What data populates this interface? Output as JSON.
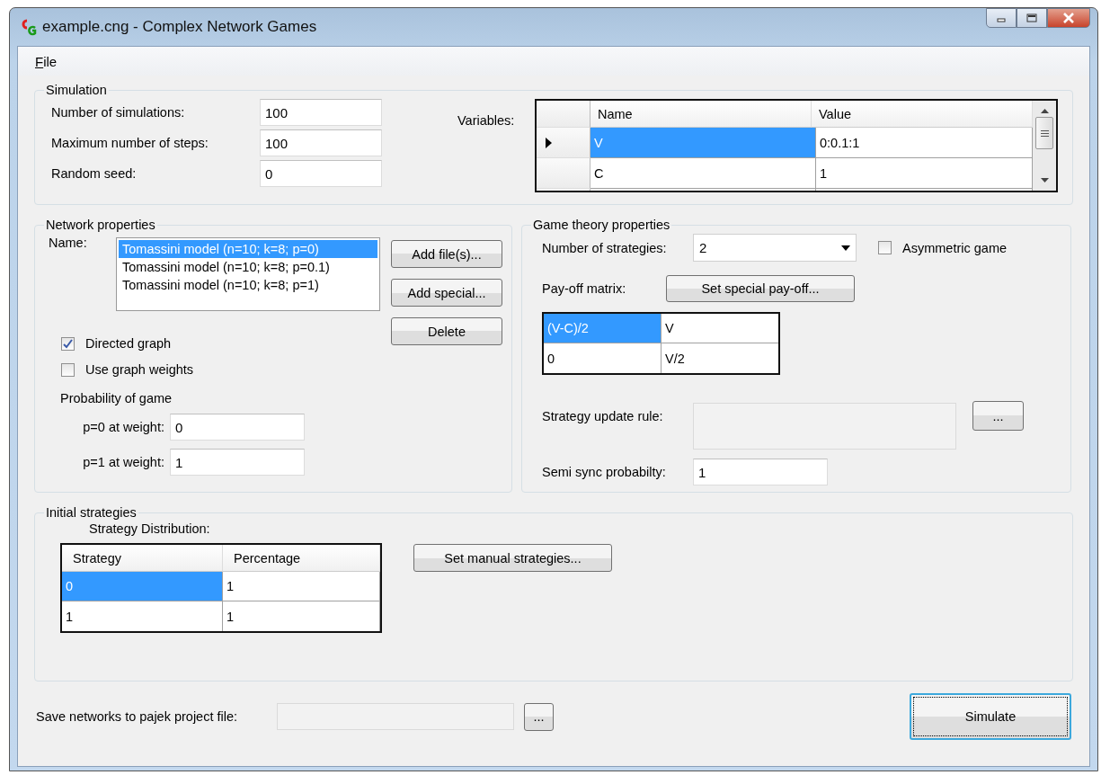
{
  "window": {
    "title": "example.cng - Complex Network Games"
  },
  "menu": [
    {
      "label": "File"
    }
  ],
  "simulation": {
    "title": "Simulation",
    "fields": [
      {
        "label": "Number of simulations:",
        "value": "100"
      },
      {
        "label": "Maximum number of steps:",
        "value": "100"
      },
      {
        "label": "Random seed:",
        "value": "0"
      }
    ],
    "variables": {
      "label": "Variables:",
      "columns": [
        "Name",
        "Value"
      ],
      "rows": [
        {
          "cells": [
            "V",
            "0:0.1:1"
          ],
          "selected": true,
          "current": true
        },
        {
          "cells": [
            "C",
            "1"
          ],
          "selected": false,
          "current": false
        }
      ]
    }
  },
  "network": {
    "title": "Network properties",
    "name_label": "Name:",
    "items": [
      {
        "label": "Tomassini model (n=10; k=8; p=0)",
        "selected": true
      },
      {
        "label": "Tomassini model (n=10; k=8; p=0.1)",
        "selected": false
      },
      {
        "label": "Tomassini model (n=10; k=8; p=1)",
        "selected": false
      }
    ],
    "buttons": [
      "Add file(s)...",
      "Add special...",
      "Delete"
    ],
    "checkboxes": [
      {
        "label": "Directed graph",
        "checked": true
      },
      {
        "label": "Use graph weights",
        "checked": false
      }
    ],
    "probability_label": "Probability of game",
    "weight_fields": [
      {
        "label": "p=0 at weight:",
        "value": "0"
      },
      {
        "label": "p=1 at weight:",
        "value": "1"
      }
    ]
  },
  "game": {
    "title": "Game theory properties",
    "strategies_label": "Number of strategies:",
    "strategies_value": "2",
    "asymmetric": {
      "label": "Asymmetric game",
      "checked": false
    },
    "payoff_label": "Pay-off matrix:",
    "payoff_button": "Set special pay-off...",
    "matrix": [
      [
        {
          "text": "(V-C)/2",
          "selected": true
        },
        {
          "text": "V",
          "selected": false
        }
      ],
      [
        {
          "text": "0",
          "selected": false
        },
        {
          "text": "V/2",
          "selected": false
        }
      ]
    ],
    "update_rule_label": "Strategy update rule:",
    "update_rule_button": "...",
    "semi_sync_label": "Semi sync probabilty:",
    "semi_sync_value": "1"
  },
  "initial": {
    "title": "Initial strategies",
    "distribution_label": "Strategy Distribution:",
    "columns": [
      "Strategy",
      "Percentage"
    ],
    "rows": [
      {
        "cells": [
          "0",
          "1"
        ],
        "selected": true
      },
      {
        "cells": [
          "1",
          "1"
        ],
        "selected": false
      }
    ],
    "manual_button": "Set manual strategies..."
  },
  "bottom": {
    "save_label": "Save networks to pajek project file:",
    "browse_button": "...",
    "simulate_button": "Simulate"
  }
}
